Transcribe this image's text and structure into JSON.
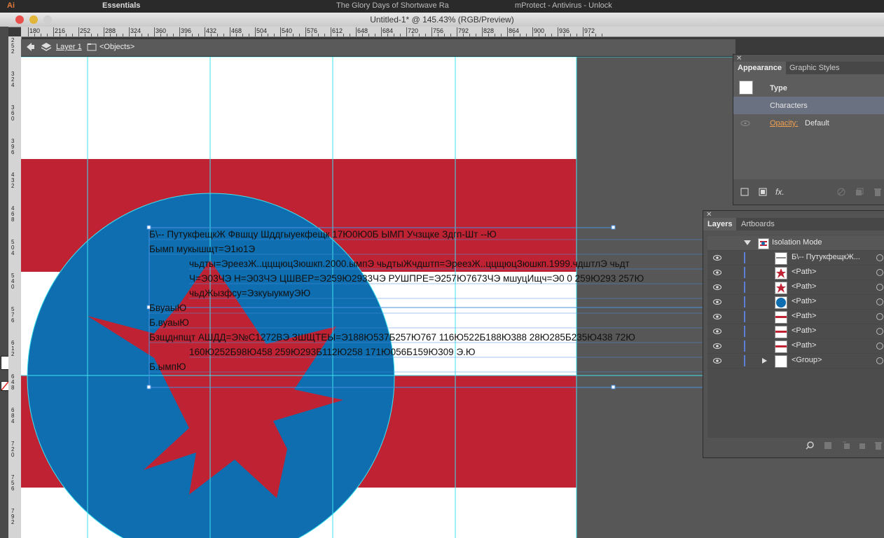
{
  "os_bar": {
    "items": [
      "Ai",
      "Essentials",
      "The Glory Days of Shortwave Ra",
      "mProtect - Antivirus - Unlock"
    ]
  },
  "window": {
    "title": "Untitled-1* @ 145.43% (RGB/Preview)"
  },
  "ruler": {
    "h_ticks": [
      "180",
      "216",
      "252",
      "288",
      "324",
      "360",
      "396",
      "432",
      "468",
      "504",
      "540",
      "576",
      "612",
      "648",
      "684",
      "720",
      "756",
      "792",
      "828",
      "864",
      "900",
      "936",
      "972"
    ],
    "v_ticks": [
      "252",
      "324",
      "360",
      "396",
      "432",
      "468",
      "504",
      "540",
      "576",
      "612",
      "648",
      "684",
      "720",
      "756",
      "792"
    ]
  },
  "breadcrumb": {
    "layer": "Layer 1",
    "objects": "<Objects>"
  },
  "artwork": {
    "text_lines": [
      "Б\\-- ПутукфещкЖ Фвшцу Шддгыуекфещк 17Ю0Ю0Б ЫМП Учзщке Здгп-Шт  --Ю",
      "Бымп мукышщт=Э1ю1Э",
      "чьдты=ЭреезЖ..ццщюцЗюшкп.2000.ымпЭ чьдтыЖчдштп=ЭреезЖ..ццщюцЗюшкп.1999.чдштлЭ чьдт",
      "Ч=Э03ЧЭ Н=Э03ЧЭ ЦШВЕР=Э259Ю2933ЧЭ РУШПРЕ=Э257Ю7673ЧЭ мшуцИщч=Э0 0 259Ю293 257Ю",
      "чьдЖызфсу=ЭзкуыукмуЭЮ",
      "БвуаыЮ",
      "Б.вуаыЮ",
      "Бзщднпщт АШДД=Э№С1272ВЭ ЗШЩТЕЫ=Э188Ю537Б257Ю767 116Ю522Б188Ю388 28Ю285Б235Ю438 72Ю",
      "160Ю252Б98Ю458 259Ю293Б112Ю258 171Ю056Б159Ю309 Э.Ю",
      "Б.ымпЮ"
    ],
    "colors": {
      "red": "#bf2233",
      "blue": "#0e6eb0",
      "white": "#ffffff"
    }
  },
  "appearance_panel": {
    "tabs": [
      "Appearance",
      "Graphic Styles"
    ],
    "rows": {
      "type": "Type",
      "characters": "Characters",
      "opacity_label": "Opacity:",
      "opacity_value": "Default"
    },
    "footer_fx": "fx."
  },
  "layers_panel": {
    "tabs": [
      "Layers",
      "Artboards"
    ],
    "header": "Isolation Mode",
    "items": [
      {
        "name": "Б\\-- ПутукфещкЖ...",
        "thumb": "text"
      },
      {
        "name": "<Path>",
        "thumb": "star"
      },
      {
        "name": "<Path>",
        "thumb": "star"
      },
      {
        "name": "<Path>",
        "thumb": "circle"
      },
      {
        "name": "<Path>",
        "thumb": "stripe"
      },
      {
        "name": "<Path>",
        "thumb": "stripe"
      },
      {
        "name": "<Path>",
        "thumb": "stripe"
      },
      {
        "name": "<Group>",
        "thumb": "blank"
      }
    ]
  }
}
